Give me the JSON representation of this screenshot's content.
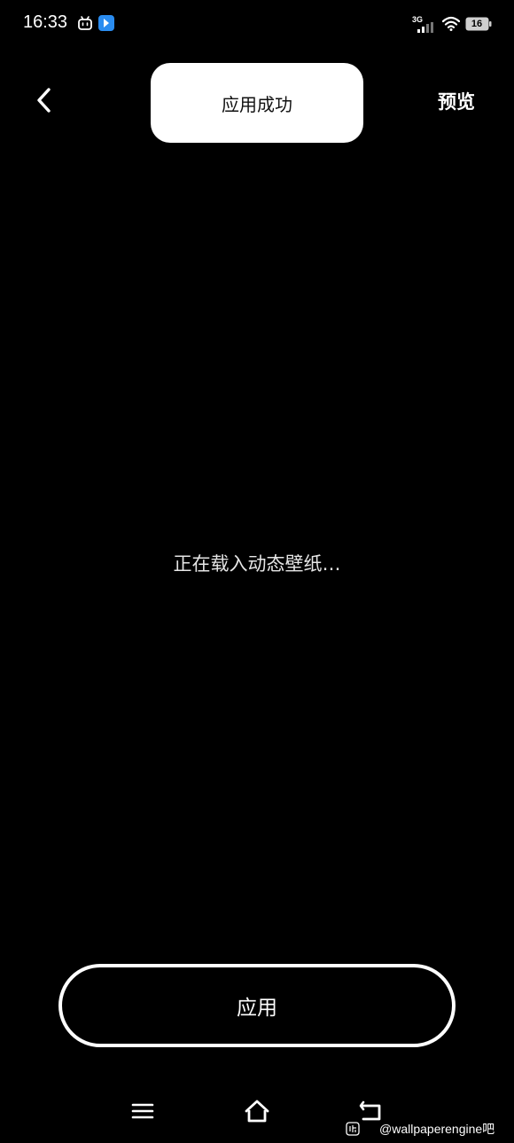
{
  "status_bar": {
    "time": "16:33",
    "network": "3G",
    "battery_level": "16",
    "icons": [
      "bilibili-icon",
      "blue-app-icon",
      "signal-icon",
      "wifi-icon",
      "battery-icon"
    ]
  },
  "header": {
    "back_icon": "chevron-left-icon",
    "preview_label": "预览"
  },
  "toast": {
    "message": "应用成功"
  },
  "main": {
    "loading_text": "正在载入动态壁纸…"
  },
  "footer": {
    "apply_label": "应用"
  },
  "nav_bar": {
    "icons": [
      "menu-icon",
      "home-icon",
      "back-icon"
    ]
  },
  "watermark": {
    "text": "@wallpaperengine吧"
  },
  "colors": {
    "background": "#000000",
    "foreground": "#ffffff",
    "toast_bg": "#ffffff",
    "toast_text": "#111111"
  }
}
